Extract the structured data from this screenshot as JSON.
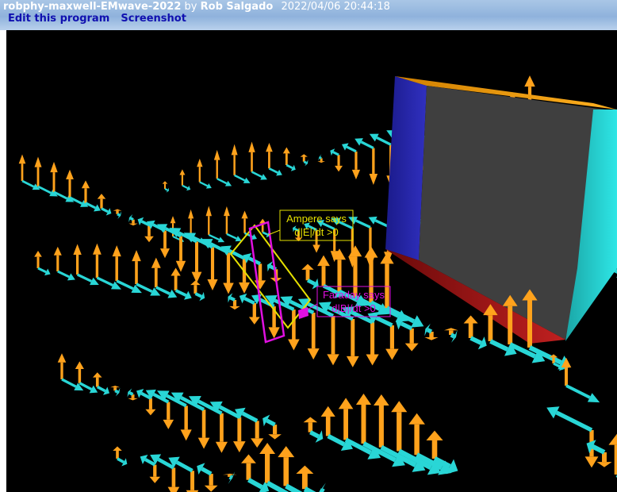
{
  "header": {
    "program_name": "robphy-maxwell-EMwave-2022",
    "by": "by",
    "author": "Rob Salgado",
    "date": "2022/04/06 20:44:18",
    "edit_link": "Edit this program",
    "screenshot_link": "Screenshot"
  },
  "scene": {
    "ampere_label_line1": "Ampere says",
    "ampere_label_line2": "d|E|/dt >0",
    "faraday_label_line1": "Faraday says",
    "faraday_label_line2": "d|B|/dt >0",
    "colors": {
      "background": "#000000",
      "e_field": "#ffa21c",
      "b_field": "#29d6d6",
      "ampere": "#e5e000",
      "faraday": "#e010e0",
      "box_face": "#3f3f3f"
    }
  }
}
